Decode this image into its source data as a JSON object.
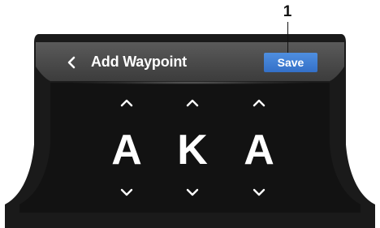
{
  "callout": {
    "number": "1"
  },
  "header": {
    "back_icon": "chevron-left-icon",
    "title": "Add Waypoint",
    "save_label": "Save"
  },
  "colors": {
    "header_background": "#4a4a4a",
    "screen_background": "#141414",
    "save_button": "#3f7fd6",
    "text": "#ffffff"
  },
  "waypoint_name": {
    "characters": [
      {
        "value": "A",
        "up_icon": "chevron-up-icon",
        "down_icon": "chevron-down-icon"
      },
      {
        "value": "K",
        "up_icon": "chevron-up-icon",
        "down_icon": "chevron-down-icon"
      },
      {
        "value": "A",
        "up_icon": "chevron-up-icon",
        "down_icon": "chevron-down-icon"
      }
    ]
  }
}
